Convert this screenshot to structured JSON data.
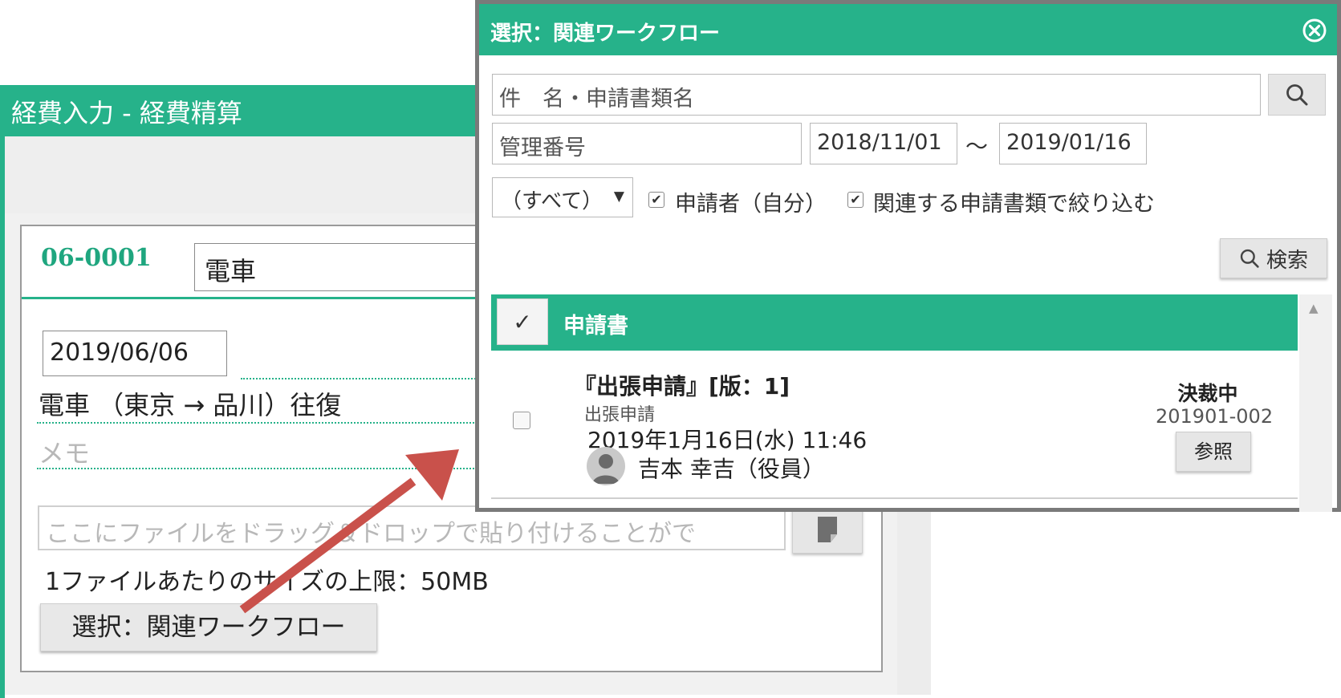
{
  "background_window": {
    "title": "経費入力 - 経費精算",
    "expense_code": "06-0001",
    "expense_name": "電車",
    "date": "2019/06/06",
    "route": "電車 （東京 → 品川）往復",
    "memo_placeholder": "メモ",
    "dropzone_placeholder": "ここにファイルをドラッグ＆ドロップで貼り付けることがで",
    "size_limit": "1ファイルあたりのサイズの上限：50MB",
    "workflow_button": "選択：関連ワークフロー"
  },
  "dialog": {
    "title": "選択：関連ワークフロー",
    "subject_placeholder": "件　名・申請書類名",
    "number_placeholder": "管理番号",
    "date_from": "2018/11/01",
    "date_separator": "～",
    "date_to": "2019/01/16",
    "type_select": "（すべて）",
    "applicant_self_label": "申請者（自分）",
    "related_filter_label": "関連する申請書類で絞り込む",
    "search_button": "検索",
    "list_header_label": "申請書",
    "header_check_glyph": "✓",
    "row": {
      "title": "『出張申請』[版：1]",
      "form_name": "出張申請",
      "datetime": "2019年1月16日(水) 11:46",
      "user": "吉本 幸吉（役員）",
      "status": "決裁中",
      "doc_number": "201901-002",
      "view_button": "参照"
    }
  },
  "colors": {
    "accent": "#26b28a",
    "code_text": "#1fa67f",
    "arrow": "#c9514b"
  },
  "icons": [
    "search-icon",
    "close-icon",
    "attach-icon",
    "avatar-icon",
    "arrow-annotation"
  ]
}
